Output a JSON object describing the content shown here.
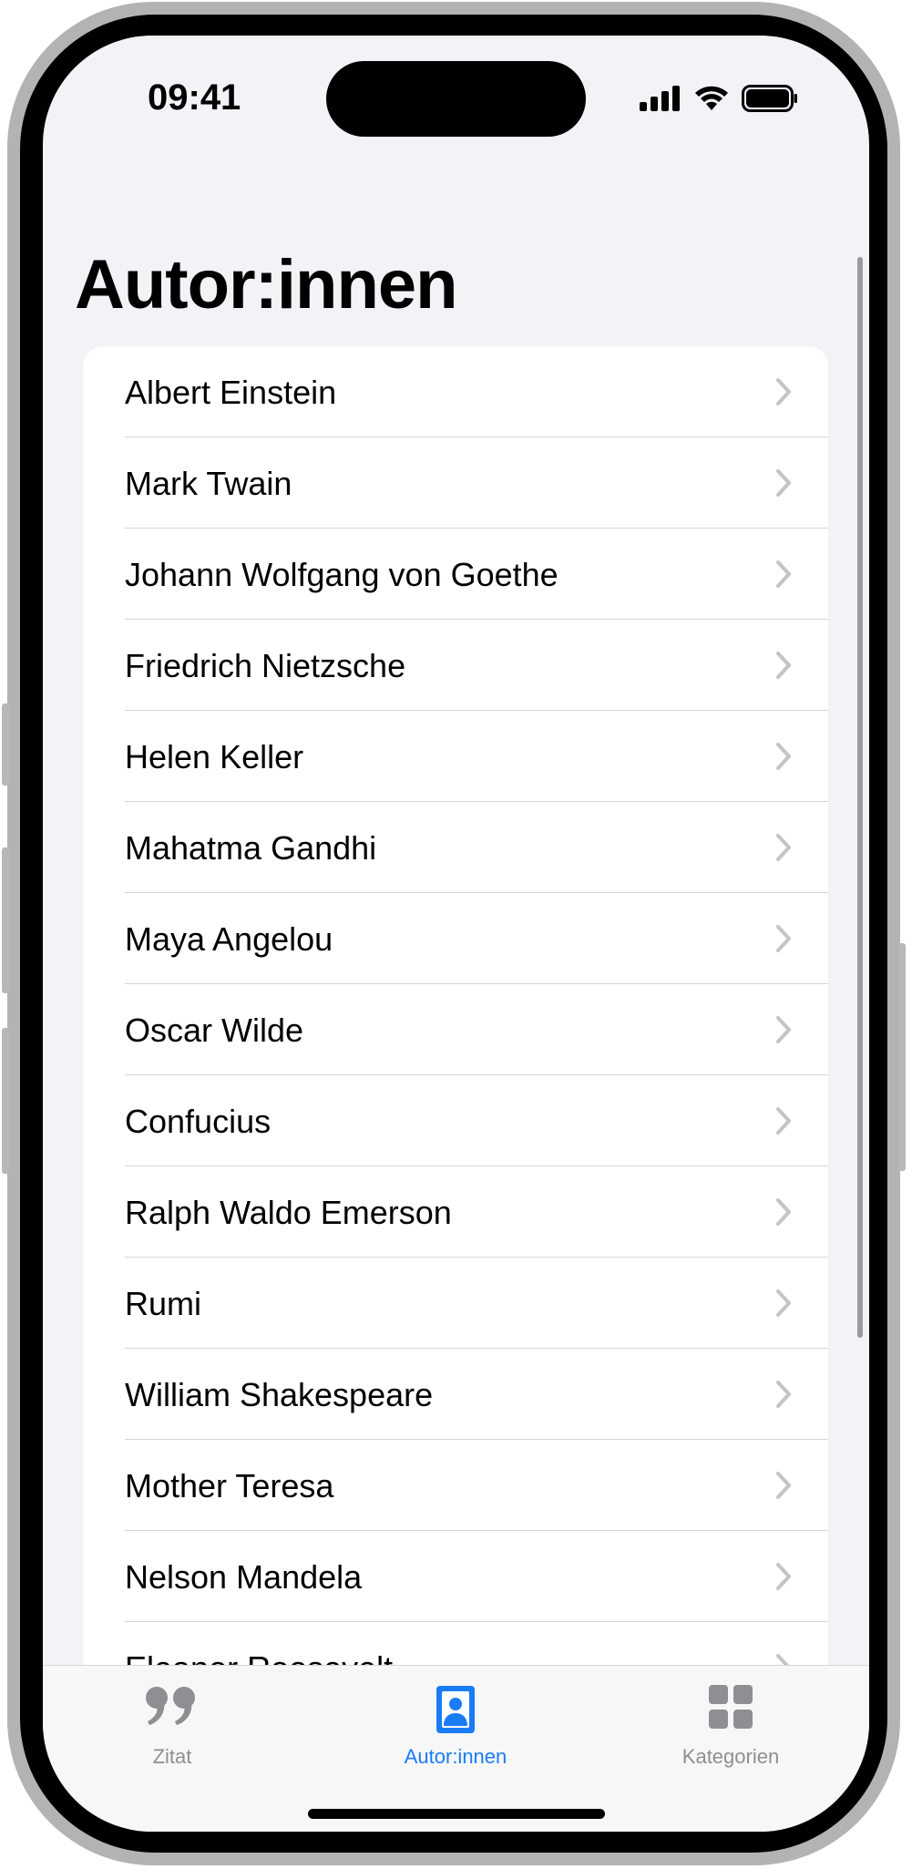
{
  "status_bar": {
    "time": "09:41"
  },
  "page": {
    "title": "Autor:innen"
  },
  "authors": [
    "Albert Einstein",
    "Mark Twain",
    "Johann Wolfgang von Goethe",
    "Friedrich Nietzsche",
    "Helen Keller",
    "Mahatma Gandhi",
    "Maya Angelou",
    "Oscar Wilde",
    "Confucius",
    "Ralph Waldo Emerson",
    "Rumi",
    "William Shakespeare",
    "Mother Teresa",
    "Nelson Mandela",
    "Eleanor Roosevelt"
  ],
  "tabbar": {
    "tabs": [
      {
        "label": "Zitat",
        "icon": "quote-icon",
        "selected": false
      },
      {
        "label": "Autor:innen",
        "icon": "person-portrait-icon",
        "selected": true
      },
      {
        "label": "Kategorien",
        "icon": "grid-icon",
        "selected": false
      }
    ]
  },
  "colors": {
    "accent": "#1a7cf5",
    "inactive": "#8e8e93",
    "background": "#f2f2f7",
    "chevron": "#c4c4c7"
  }
}
